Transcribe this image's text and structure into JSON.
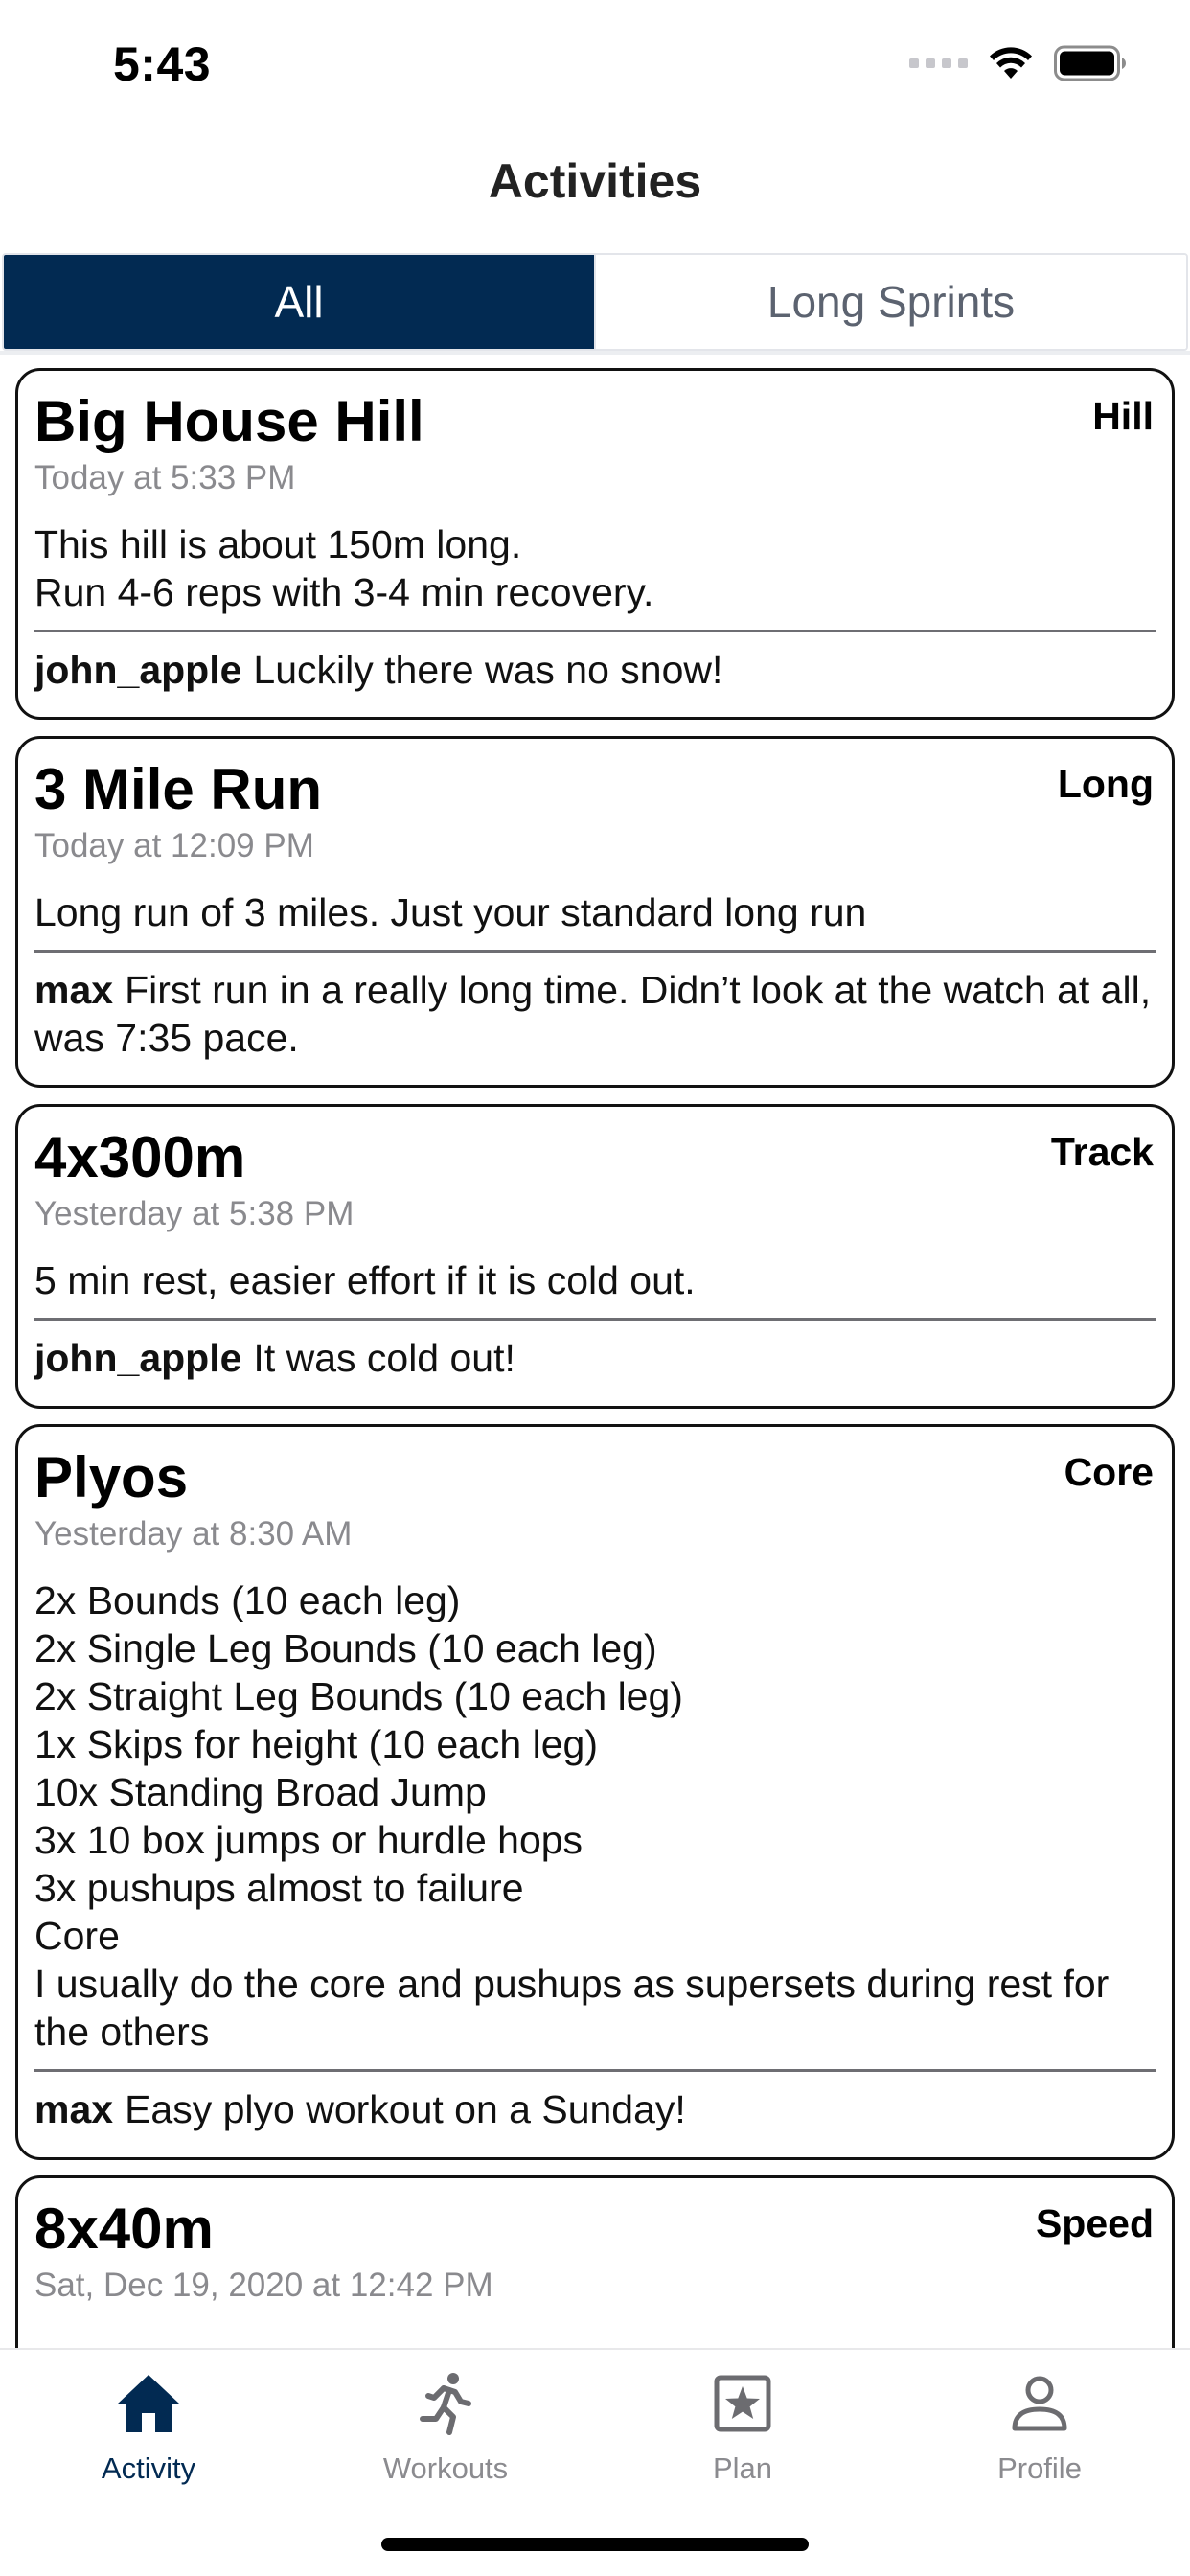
{
  "status_bar": {
    "time": "5:43",
    "icons": [
      "cellular-signal-icon",
      "wifi-icon",
      "battery-icon"
    ]
  },
  "header": {
    "title": "Activities"
  },
  "segment": {
    "tabs": [
      {
        "label": "All",
        "selected": true
      },
      {
        "label": "Long Sprints",
        "selected": false
      }
    ]
  },
  "activities": [
    {
      "title": "Big House Hill",
      "tag": "Hill",
      "time": "Today at 5:33 PM",
      "description": "This hill is about 150m long.\nRun 4-6 reps with 3-4 min recovery.",
      "comment_user": "john_apple",
      "comment_text": "Luckily there was no snow!"
    },
    {
      "title": "3 Mile Run",
      "tag": "Long",
      "time": "Today at 12:09 PM",
      "description": "Long run of 3 miles. Just your standard long run",
      "comment_user": "max",
      "comment_text": "First run in a really long time. Didn’t look at the watch at all, was 7:35 pace."
    },
    {
      "title": "4x300m",
      "tag": "Track",
      "time": "Yesterday at 5:38 PM",
      "description": "5 min rest, easier effort if it is cold out.",
      "comment_user": "john_apple",
      "comment_text": "It was cold out!"
    },
    {
      "title": "Plyos",
      "tag": "Core",
      "time": "Yesterday at 8:30 AM",
      "description": "2x Bounds (10 each leg)\n2x Single Leg Bounds (10 each leg)\n2x Straight Leg Bounds (10 each leg)\n1x Skips for height (10 each leg)\n10x Standing Broad Jump\n3x 10 box jumps or hurdle hops\n3x pushups almost to failure\nCore\nI usually do the core and pushups as supersets during rest for the others",
      "comment_user": "max",
      "comment_text": "Easy plyo workout on a Sunday!"
    },
    {
      "title": "8x40m",
      "tag": "Speed",
      "time": "Sat, Dec 19, 2020 at 12:42 PM",
      "description": "",
      "comment_user": "",
      "comment_text": ""
    }
  ],
  "tab_bar": {
    "items": [
      {
        "label": "Activity",
        "icon": "home-icon",
        "active": true
      },
      {
        "label": "Workouts",
        "icon": "runner-icon",
        "active": false
      },
      {
        "label": "Plan",
        "icon": "star-square-icon",
        "active": false
      },
      {
        "label": "Profile",
        "icon": "person-icon",
        "active": false
      }
    ]
  },
  "colors": {
    "accent": "#022a52",
    "inactive_tab": "#8b8b8f",
    "timestamp": "#8a8a8e"
  }
}
